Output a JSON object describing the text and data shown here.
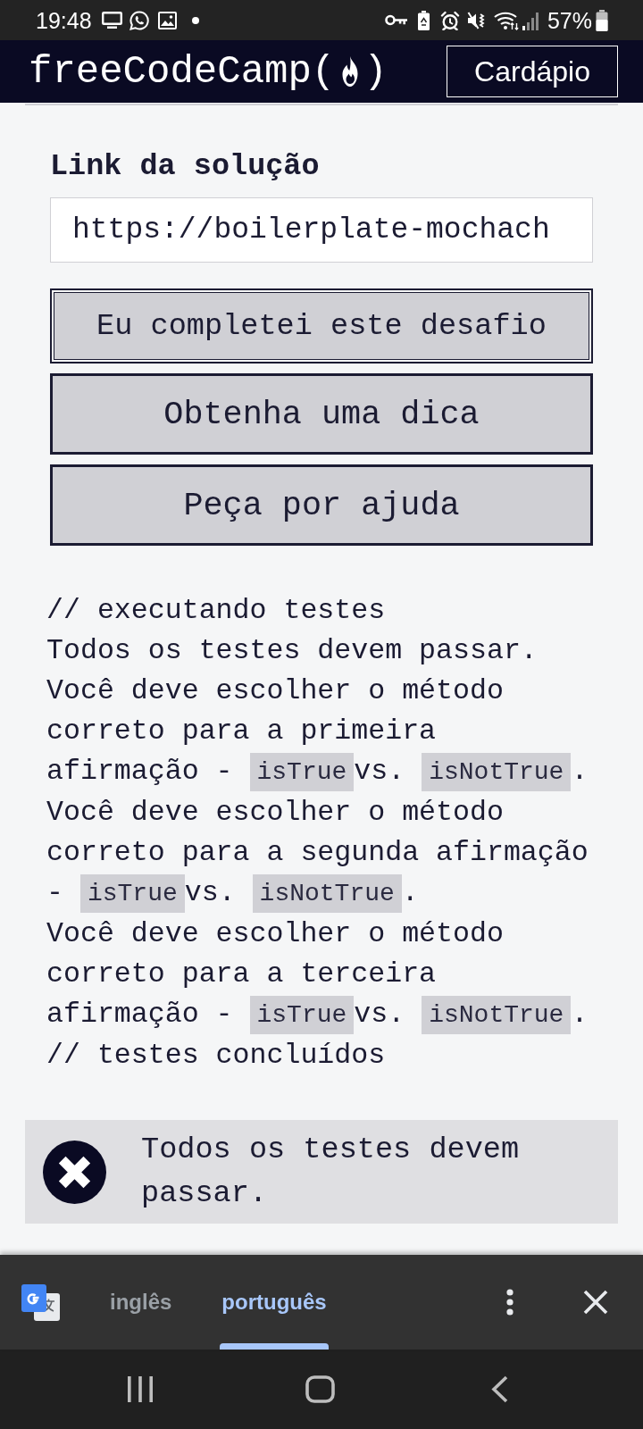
{
  "status_bar": {
    "time": "19:48",
    "battery": "57%"
  },
  "header": {
    "logo_before": "freeCodeCamp(",
    "logo_after": ")",
    "menu_button": "Cardápio"
  },
  "form": {
    "label": "Link da solução",
    "value": "https://boilerplate-mochach",
    "buttons": [
      {
        "label": "Eu completei este desafio",
        "kind": "submit",
        "focused": true
      },
      {
        "label": "Obtenha uma dica",
        "kind": "secondary",
        "focused": false
      },
      {
        "label": "Peça por ajuda",
        "kind": "secondary",
        "focused": false
      }
    ]
  },
  "test_output": [
    {
      "segments": [
        {
          "kind": "text",
          "text": "// executando testes"
        }
      ]
    },
    {
      "segments": [
        {
          "kind": "text",
          "text": "Todos os testes devem passar."
        }
      ]
    },
    {
      "segments": [
        {
          "kind": "text",
          "text": "Você deve escolher o método correto para a primeira afirmação - "
        },
        {
          "kind": "code",
          "text": "isTrue"
        },
        {
          "kind": "text",
          "text": "vs. "
        },
        {
          "kind": "code",
          "text": "isNotTrue"
        },
        {
          "kind": "text",
          "text": "."
        }
      ]
    },
    {
      "segments": [
        {
          "kind": "text",
          "text": "Você deve escolher o método correto para a segunda afirmação - "
        },
        {
          "kind": "code",
          "text": "isTrue"
        },
        {
          "kind": "text",
          "text": "vs. "
        },
        {
          "kind": "code",
          "text": "isNotTrue"
        },
        {
          "kind": "text",
          "text": "."
        }
      ]
    },
    {
      "segments": [
        {
          "kind": "text",
          "text": "Você deve escolher o método correto para a terceira afirmação - "
        },
        {
          "kind": "code",
          "text": "isTrue"
        },
        {
          "kind": "text",
          "text": "vs. "
        },
        {
          "kind": "code",
          "text": "isNotTrue"
        },
        {
          "kind": "text",
          "text": "."
        }
      ]
    },
    {
      "segments": [
        {
          "kind": "text",
          "text": "// testes concluídos"
        }
      ]
    }
  ],
  "test_results": [
    {
      "passed": false,
      "text": "Todos os testes devem passar."
    }
  ],
  "translate_bar": {
    "tabs": [
      {
        "label": "inglês",
        "selected": false
      },
      {
        "label": "português",
        "selected": true
      }
    ]
  }
}
